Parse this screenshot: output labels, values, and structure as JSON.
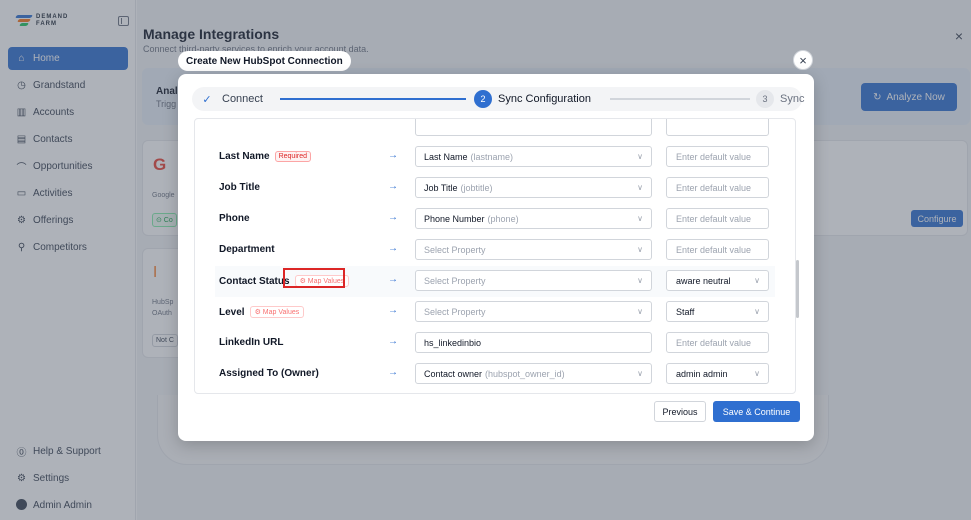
{
  "brand": {
    "line1": "DEMAND",
    "line2": "FARM"
  },
  "sidebar": {
    "items": [
      {
        "label": "Home",
        "icon": "home-icon",
        "glyph": "⌂",
        "active": true
      },
      {
        "label": "Grandstand",
        "icon": "clock-icon",
        "glyph": "◷"
      },
      {
        "label": "Accounts",
        "icon": "building-icon",
        "glyph": "▥"
      },
      {
        "label": "Contacts",
        "icon": "contacts-icon",
        "glyph": "▤"
      },
      {
        "label": "Opportunities",
        "icon": "opportunity-icon",
        "glyph": "⌒"
      },
      {
        "label": "Activities",
        "icon": "activities-icon",
        "glyph": "▭"
      },
      {
        "label": "Offerings",
        "icon": "offerings-icon",
        "glyph": "⚙"
      },
      {
        "label": "Competitors",
        "icon": "competitors-icon",
        "glyph": "⚲"
      }
    ],
    "bottom": [
      {
        "label": "Help & Support",
        "icon": "help-icon",
        "glyph": "⓪"
      },
      {
        "label": "Settings",
        "icon": "settings-icon",
        "glyph": "⚙"
      },
      {
        "label": "Admin Admin",
        "icon": "avatar-icon",
        "glyph": ""
      }
    ]
  },
  "page": {
    "title": "Manage Integrations",
    "subtitle": "Connect third-party services to enrich your account data.",
    "close_glyph": "×",
    "banner_title": "Anal",
    "banner_sub": "Trigg",
    "analyze_label": "Analyze Now",
    "configure_label": "Configure",
    "google_letter": "G",
    "google_sub": "Google",
    "google_status": "⊙ Co",
    "hubspot_sub1": "HubSp",
    "hubspot_sub2": "OAuth",
    "hubspot_status": "Not C"
  },
  "modal": {
    "tag": "Create New HubSpot Connection",
    "close_glyph": "×",
    "steps": [
      {
        "num": "✓",
        "label": "Connect"
      },
      {
        "num": "2",
        "label": "Sync Configuration"
      },
      {
        "num": "3",
        "label": "Sync"
      }
    ],
    "rows": [
      {
        "label": "Last Name",
        "badge": "Required",
        "badge_type": "required",
        "prop": "Last Name",
        "prop_key": "(lastname)",
        "default": "Enter default value",
        "default_kind": "input"
      },
      {
        "label": "Job Title",
        "badge": "",
        "prop": "Job Title",
        "prop_key": "(jobtitle)",
        "default": "Enter default value",
        "default_kind": "input"
      },
      {
        "label": "Phone",
        "badge": "",
        "prop": "Phone Number",
        "prop_key": "(phone)",
        "default": "Enter default value",
        "default_kind": "input"
      },
      {
        "label": "Department",
        "badge": "",
        "prop": "Select Property",
        "prop_key": "",
        "placeholder": true,
        "default": "Enter default value",
        "default_kind": "input"
      },
      {
        "label": "Contact Status",
        "badge": "⚙ Map Values",
        "badge_type": "map",
        "highlight": true,
        "prop": "Select Property",
        "prop_key": "",
        "placeholder": true,
        "default": "aware neutral",
        "default_kind": "select"
      },
      {
        "label": "Level",
        "badge": "⚙ Map Values",
        "badge_type": "map",
        "prop": "Select Property",
        "prop_key": "",
        "placeholder": true,
        "default": "Staff",
        "default_kind": "select"
      },
      {
        "label": "LinkedIn URL",
        "badge": "",
        "prop": "hs_linkedinbio",
        "prop_key": "",
        "default": "Enter default value",
        "default_kind": "input",
        "no_chevron": true
      },
      {
        "label": "Assigned To (Owner)",
        "badge": "",
        "prop": "Contact owner",
        "prop_key": "(hubspot_owner_id)",
        "default": "admin admin",
        "default_kind": "select"
      }
    ],
    "arrow_glyph": "→",
    "chevron_glyph": "∨",
    "previous_label": "Previous",
    "save_label": "Save & Continue"
  },
  "colors": {
    "primary": "#2f6fd0",
    "required": "#dc2626",
    "logo": [
      "#2f6fd0",
      "#f97316",
      "#22c55e"
    ]
  }
}
